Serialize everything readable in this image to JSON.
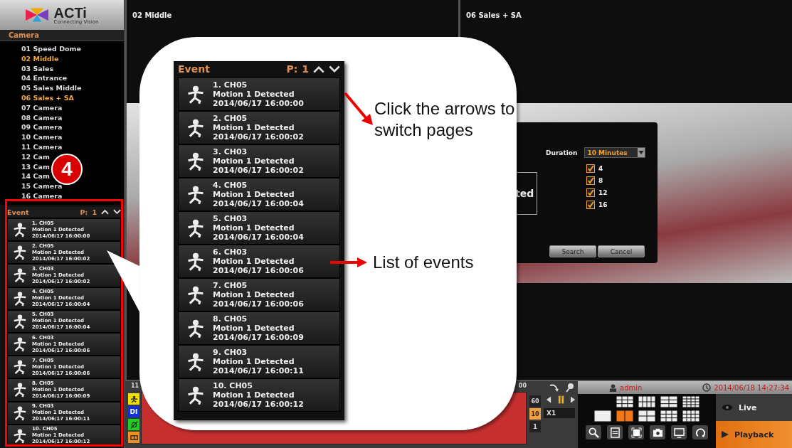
{
  "sidebar": {
    "logo": {
      "name": "ACTi",
      "tagline": "Connecting Vision"
    },
    "camera_header": "Camera",
    "cameras": [
      {
        "label": "01 Speed Dome",
        "selected": false
      },
      {
        "label": "02 Middle",
        "selected": true
      },
      {
        "label": "03 Sales",
        "selected": false
      },
      {
        "label": "04 Entrance",
        "selected": false
      },
      {
        "label": "05 Sales Middle",
        "selected": false
      },
      {
        "label": "06 Sales + SA",
        "selected": true
      },
      {
        "label": "07 Camera",
        "selected": false
      },
      {
        "label": "08 Camera",
        "selected": false
      },
      {
        "label": "09 Camera",
        "selected": false
      },
      {
        "label": "10 Camera",
        "selected": false
      },
      {
        "label": "11 Camera",
        "selected": false
      },
      {
        "label": "12 Cam",
        "selected": false
      },
      {
        "label": "13 Cam",
        "selected": false
      },
      {
        "label": "14 Cam",
        "selected": false
      },
      {
        "label": "15 Camera",
        "selected": false
      },
      {
        "label": "16 Camera",
        "selected": false
      }
    ],
    "badge": "4",
    "event_panel": {
      "title": "Event",
      "page_label": "P:",
      "page": "1",
      "events": [
        {
          "title": "1. CH05",
          "description": "Motion 1 Detected",
          "time": "2014/06/17 16:00:00"
        },
        {
          "title": "2. CH05",
          "description": "Motion 1 Detected",
          "time": "2014/06/17 16:00:02"
        },
        {
          "title": "3. CH03",
          "description": "Motion 1 Detected",
          "time": "2014/06/17 16:00:02"
        },
        {
          "title": "4. CH05",
          "description": "Motion 1 Detected",
          "time": "2014/06/17 16:00:04"
        },
        {
          "title": "5. CH03",
          "description": "Motion 1 Detected",
          "time": "2014/06/17 16:00:04"
        },
        {
          "title": "6. CH03",
          "description": "Motion 1 Detected",
          "time": "2014/06/17 16:00:06"
        },
        {
          "title": "7. CH05",
          "description": "Motion 1 Detected",
          "time": "2014/06/17 16:00:06"
        },
        {
          "title": "8. CH05",
          "description": "Motion 1 Detected",
          "time": "2014/06/17 16:00:09"
        },
        {
          "title": "9. CH03",
          "description": "Motion 1 Detected",
          "time": "2014/06/17 16:00:11"
        },
        {
          "title": "10. CH05",
          "description": "Motion 1 Detected",
          "time": "2014/06/17 16:00:12"
        }
      ]
    }
  },
  "panes": [
    {
      "title": "02 Middle"
    },
    {
      "title": "06 Sales + SA"
    }
  ],
  "search_dialog": {
    "fragment": "ted",
    "duration_label": "Duration",
    "duration": "10 Minutes",
    "channels": [
      {
        "label": "4",
        "checked": true
      },
      {
        "label": "8",
        "checked": true
      },
      {
        "label": "12",
        "checked": true
      },
      {
        "label": "16",
        "checked": true
      }
    ],
    "buttons": [
      "Search",
      "Cancel"
    ]
  },
  "timeline": {
    "labels": [
      "11",
      "00"
    ],
    "filters": [
      {
        "kind": "motion",
        "color": "#f0e000"
      },
      {
        "kind": "text",
        "label": "DI",
        "color": "#1030e0"
      },
      {
        "kind": "link",
        "color": "#20d020"
      },
      {
        "kind": "box",
        "color": "#f09020"
      }
    ],
    "zoom_levels": [
      {
        "label": "60",
        "selected": false
      },
      {
        "label": "10",
        "selected": true
      },
      {
        "label": "1",
        "selected": false
      }
    ],
    "speed": "X1"
  },
  "status": {
    "user": "admin",
    "datetime": "2014/06/18 14:27:34"
  },
  "layouts": [
    {
      "kind": "corner",
      "selected": false
    },
    {
      "kind": "wide",
      "selected": false
    },
    {
      "kind": "split",
      "selected": false
    },
    {
      "kind": "sixteen",
      "selected": false
    },
    {
      "kind": "single",
      "selected": false
    },
    {
      "kind": "dual",
      "selected": true
    },
    {
      "kind": "quad",
      "selected": false
    },
    {
      "kind": "nine",
      "selected": false
    },
    {
      "kind": "twelve",
      "selected": false
    }
  ],
  "modes": [
    {
      "label": "Live",
      "selected": false
    },
    {
      "label": "Playback",
      "selected": true
    }
  ],
  "callout": {
    "event_panel": {
      "title": "Event",
      "page_label": "P:",
      "page": "1",
      "events": [
        {
          "title": "1. CH05",
          "description": "Motion 1 Detected",
          "time": "2014/06/17 16:00:00"
        },
        {
          "title": "2. CH05",
          "description": "Motion 1 Detected",
          "time": "2014/06/17 16:00:02"
        },
        {
          "title": "3. CH03",
          "description": "Motion 1 Detected",
          "time": "2014/06/17 16:00:02"
        },
        {
          "title": "4. CH05",
          "description": "Motion 1 Detected",
          "time": "2014/06/17 16:00:04"
        },
        {
          "title": "5. CH03",
          "description": "Motion 1 Detected",
          "time": "2014/06/17 16:00:04"
        },
        {
          "title": "6. CH03",
          "description": "Motion 1 Detected",
          "time": "2014/06/17 16:00:06"
        },
        {
          "title": "7. CH05",
          "description": "Motion 1 Detected",
          "time": "2014/06/17 16:00:06"
        },
        {
          "title": "8. CH05",
          "description": "Motion 1 Detected",
          "time": "2014/06/17 16:00:09"
        },
        {
          "title": "9. CH03",
          "description": "Motion 1 Detected",
          "time": "2014/06/17 16:00:11"
        },
        {
          "title": "10. CH05",
          "description": "Motion 1 Detected",
          "time": "2014/06/17 16:00:12"
        }
      ]
    },
    "annotations": [
      "Click the arrows to switch pages",
      "List of events"
    ]
  }
}
